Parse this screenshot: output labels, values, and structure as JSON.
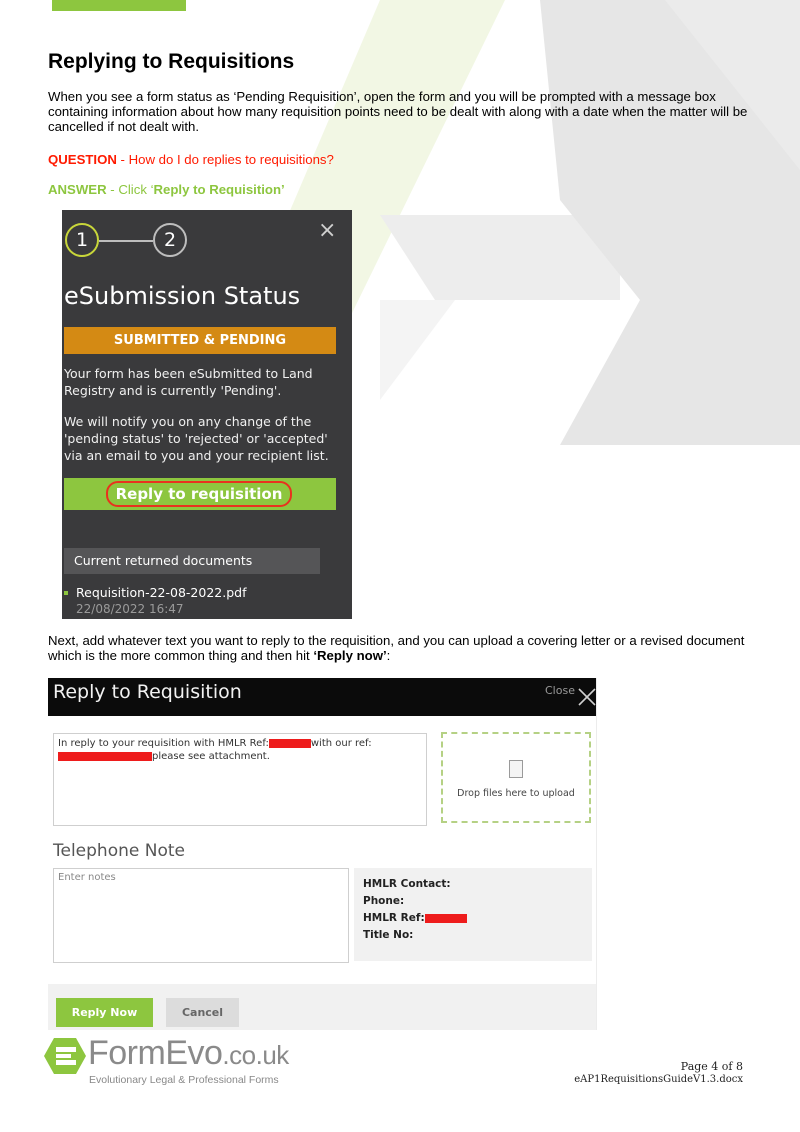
{
  "doc": {
    "heading": "Replying to Requisitions",
    "intro": "When you see a form status as ‘Pending Requisition’, open the form and you will be prompted with a message box containing information about how many requisition points need to be dealt with along with a date when the matter will be cancelled if not dealt with.",
    "question_label": "QUESTION",
    "question_text": " - How do I do replies to requisitions?",
    "answer_label": "ANSWER",
    "answer_text": " - Click ‘",
    "answer_bold": "Reply to Requisition’",
    "next_text": "Next, add whatever text you want to reply to the requisition, and you can upload a covering letter or a revised document which is the more common thing and then hit ",
    "next_bold": "‘Reply now’",
    "next_end": ":"
  },
  "status_panel": {
    "step1": "1",
    "step2": "2",
    "close": "×",
    "title": "eSubmission Status",
    "badge": "SUBMITTED & PENDING",
    "para1": "Your form has been eSubmitted to Land Registry and is currently 'Pending'.",
    "para2": "We will notify you on any change of the 'pending status' to 'rejected' or 'accepted' via an email to you and your recipient list.",
    "reply_button": "Reply to requisition",
    "docs_header": "Current returned documents",
    "doc_name": "Requisition-22-08-2022.pdf",
    "doc_date": "22/08/2022 16:47"
  },
  "reply_modal": {
    "title": "Reply to Requisition",
    "close_label": "Close",
    "text_part1": "In reply to your requisition with HMLR Ref:",
    "text_part2": "with our ref:",
    "text_part3": "please see attachment.",
    "drop_text": "Drop files here to upload",
    "tel_title": "Telephone Note",
    "notes_placeholder": "Enter notes",
    "hmlr_contact": "HMLR Contact:",
    "hmlr_phone": "Phone:",
    "hmlr_ref": "HMLR Ref:",
    "hmlr_title_no": "Title No:",
    "reply_now": "Reply Now",
    "cancel": "Cancel"
  },
  "footer": {
    "brand": "FormEvo",
    "domain": ".co.uk",
    "tagline": "Evolutionary Legal & Professional Forms",
    "page": "Page 4 of 8",
    "file": "eAP1RequisitionsGuideV1.3.docx"
  },
  "colors": {
    "brand_green": "#8dc63f",
    "question_red": "#ff1a00",
    "badge_orange": "#d48a14",
    "panel_dark": "#3a3a3c"
  }
}
